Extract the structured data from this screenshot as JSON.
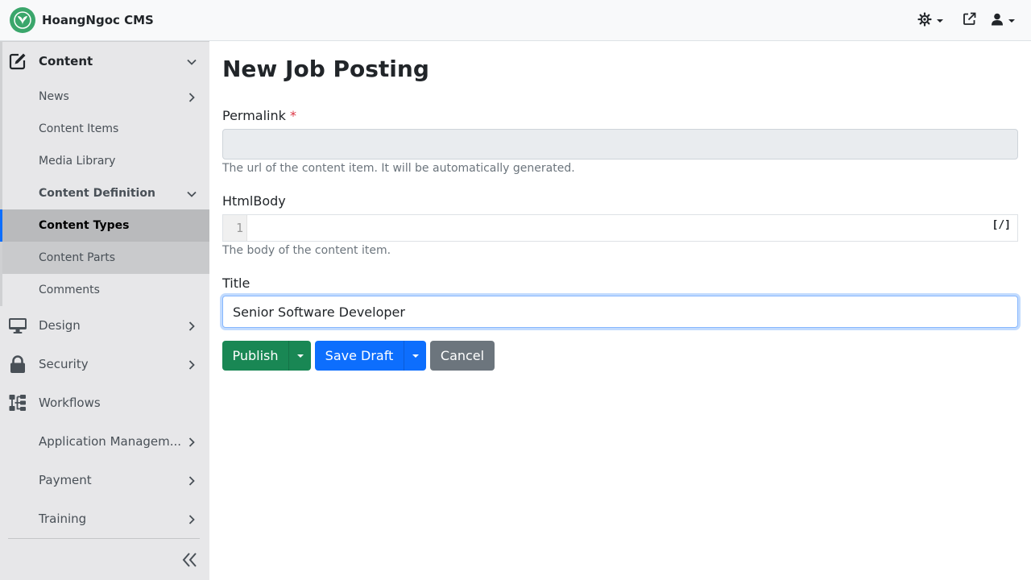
{
  "app": {
    "brand_name": "HoangNgoc CMS",
    "brand_color": "#3aa66b"
  },
  "topbar": {
    "icons": [
      "theme-toggle-icon",
      "external-link-icon",
      "user-icon"
    ]
  },
  "sidebar": {
    "groups": [
      {
        "label": "Content",
        "icon": "edit-icon",
        "expanded": true
      },
      {
        "label": "Design",
        "icon": "monitor-icon"
      },
      {
        "label": "Security",
        "icon": "lock-icon"
      },
      {
        "label": "Workflows",
        "icon": "sitemap-icon"
      },
      {
        "label": "Application Managem..."
      },
      {
        "label": "Payment"
      },
      {
        "label": "Training"
      }
    ],
    "content_items": [
      {
        "label": "News"
      },
      {
        "label": "Content Items"
      },
      {
        "label": "Media Library"
      },
      {
        "label": "Content Definition"
      },
      {
        "label": "Content Types",
        "active": true
      },
      {
        "label": "Content Parts"
      },
      {
        "label": "Comments"
      }
    ],
    "accent_color": "#0d6efd"
  },
  "main": {
    "title": "New Job Posting",
    "permalink": {
      "label": "Permalink",
      "required_mark": "*",
      "value": "",
      "help": "The url of the content item. It will be automatically generated."
    },
    "htmlbody": {
      "label": "HtmlBody",
      "line_number": "1",
      "toggle": "[/]",
      "help": "The body of the content item."
    },
    "title_field": {
      "label": "Title",
      "value": "Senior Software Developer"
    },
    "buttons": {
      "publish": "Publish",
      "save_draft": "Save Draft",
      "cancel": "Cancel"
    },
    "colors": {
      "success": "#198754",
      "primary": "#0d6efd",
      "secondary": "#6c757d"
    }
  }
}
